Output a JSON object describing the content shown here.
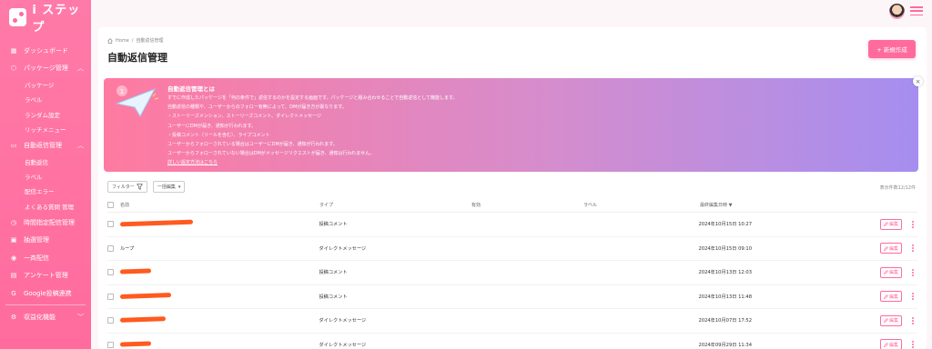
{
  "app": {
    "logo_text": "i ステップ"
  },
  "sidebar": {
    "items": [
      {
        "label": "ダッシュボード",
        "icon": "dashboard-icon"
      },
      {
        "label": "パッケージ管理",
        "icon": "package-icon",
        "expanded": true,
        "sub": [
          "パッケージ",
          "ラベル",
          "ランダム設定",
          "リッチメニュー"
        ]
      },
      {
        "label": "自動返信管理",
        "icon": "chat-icon",
        "expanded": true,
        "sub": [
          "自動返信",
          "ラベル",
          "配信エラー",
          "よくある質問 管理"
        ]
      },
      {
        "label": "時間指定配信管理",
        "icon": "clock-icon"
      },
      {
        "label": "抽選管理",
        "icon": "gift-icon"
      },
      {
        "label": "一斉配信",
        "icon": "broadcast-icon"
      },
      {
        "label": "アンケート管理",
        "icon": "document-icon"
      },
      {
        "label": "Google投稿連携",
        "icon": "google-icon"
      },
      {
        "label": "収益化機能",
        "icon": "monetize-icon"
      }
    ]
  },
  "breadcrumb": {
    "home": "Home",
    "current": "自動返信管理"
  },
  "page": {
    "title": "自動返信管理",
    "new_button": "+ 新規作成"
  },
  "banner": {
    "title": "自動返信管理とは",
    "lines": [
      "すでに作成したパッケージを「何の条件で」返信するのかを設定する画面です。パッケージと組み合わせることで自動返信として機能します。",
      "自動返信の種類や、ユーザーからのフォロー有無によって、DMが届き方が異なります。",
      "・ストーリーズメンション、ストーリーズコメント、ダイレクトメッセージ",
      "ユーザーにDMが届き、通知が行われます。",
      "・投稿コメント（リールを含む）、ライブコメント",
      "ユーザーからフォローされている場合はユーザーにDMが届き、通知が行われます。",
      "ユーザーからフォローされていない場合はDMがメッセージリクエストが届き、通知は行われません。"
    ],
    "link": "詳しい設定方法はこちら"
  },
  "filters": {
    "filter_label": "フィルター",
    "bulk_label": "一括編集"
  },
  "count_text": "表示件数12/12件",
  "table": {
    "headers": {
      "name": "名前",
      "type": "タイプ",
      "status": "有効",
      "label": "ラベル",
      "date": "最終編集日時 ▼"
    },
    "rows": [
      {
        "name": "",
        "redacted": true,
        "redact_width": 80,
        "type": "投稿コメント",
        "enabled": true,
        "label": "",
        "date": "2024年10月15日 10:27",
        "edit": "編集"
      },
      {
        "name": "ループ",
        "redacted": false,
        "redact_width": 0,
        "type": "ダイレクトメッセージ",
        "enabled": false,
        "label": "",
        "date": "2024年10月15日 09:10",
        "edit": "編集"
      },
      {
        "name": "",
        "redacted": true,
        "redact_width": 34,
        "type": "投稿コメント",
        "enabled": true,
        "label": "",
        "date": "2024年10月13日 12:03",
        "edit": "編集"
      },
      {
        "name": "",
        "redacted": true,
        "redact_width": 56,
        "type": "投稿コメント",
        "enabled": true,
        "label": "",
        "date": "2024年10月13日 11:48",
        "edit": "編集"
      },
      {
        "name": "",
        "redacted": true,
        "redact_width": 50,
        "type": "ダイレクトメッセージ",
        "enabled": true,
        "label": "",
        "date": "2024年10月07日 17:52",
        "edit": "編集"
      },
      {
        "name": "",
        "redacted": true,
        "redact_width": 34,
        "type": "ダイレクトメッセージ",
        "enabled": true,
        "label": "",
        "date": "2024年09月29日 11:34",
        "edit": "編集"
      }
    ]
  },
  "colors": {
    "brand": "#ff6b9d",
    "redaction": "#ff5a1f"
  }
}
